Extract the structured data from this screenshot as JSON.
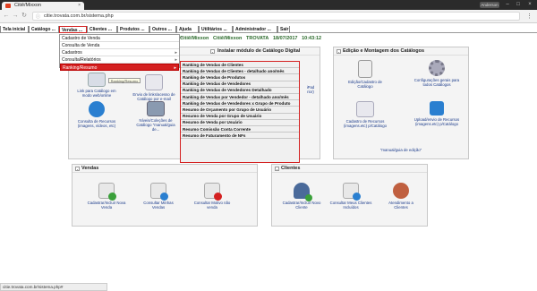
{
  "browser": {
    "tab_title": "Citiê/Mixxon",
    "tab_close": "×",
    "user": "Anderson",
    "url": "citie.trovata.com.br/sistema.php",
    "window_buttons": [
      "–",
      "□",
      "×"
    ]
  },
  "menubar": {
    "items": [
      "Tela inicial",
      "Catálogo ...",
      "Vendas ...",
      "Clientes ...",
      "Produtos ...",
      "Outros ...",
      "Ajuda ...",
      "Utilitários ...",
      "Administrador ...",
      "Sair"
    ],
    "active_index": 2
  },
  "vendas_menu": {
    "items": [
      {
        "label": "Cadastro de Venda",
        "submenu": false
      },
      {
        "label": "Consulta de Venda",
        "submenu": false
      },
      {
        "label": "Cadastros",
        "submenu": true
      },
      {
        "label": "Consulta/Relatórios",
        "submenu": true
      },
      {
        "label": "Ranking/Resumo",
        "submenu": true,
        "highlighted": true
      }
    ],
    "arrow": "▸"
  },
  "ranking_submenu": {
    "items": [
      "Ranking de Vendas de Clientes",
      "Ranking de Vendas de Clientes - detalhado ano/mês",
      "Ranking de Vendas de Produtos",
      "Ranking de Vendas de Vendedores",
      "Ranking de Vendas de Vendedores Detalhado",
      "Ranking de Vendas por Vendedor - detalhado ano/mês",
      "Ranking de Vendas de Vendedores x Grupo de Produto",
      "Resumo de Orçamento por Grupo de Usuário",
      "Resumo de Venda por Grupo de Usuário",
      "Resumo de Venda por Usuário",
      "Resumo Comissão Conta Corrente",
      "Resumo de Faturamento de NFs"
    ]
  },
  "info_strip": {
    "company": "Citiê/Mixxon",
    "company2": "Citiê/Mixxon",
    "system": "TROVATA",
    "date": "18/07/2017",
    "time": "10:43:12"
  },
  "panel_catalogo": {
    "title": "Instalar módulo de Catálogo Digital",
    "toggle": "-",
    "tooltip": "Ranking/Resumo",
    "items": [
      {
        "label": "Link para Catálogo em modo web/online",
        "icon": "link-icon"
      },
      {
        "label": "Envio de links/acesso de Catálogo por e-mail",
        "icon": "email-icon"
      },
      {
        "label": "Consulta de Recursos (imagens, vídeos, etc)",
        "icon": "globe-icon"
      },
      {
        "label": "Níveis/Coleções de Catálogo \"manual/guia de...",
        "icon": "document-icon"
      },
      {
        "label": "iPad",
        "icon": "tablet-icon"
      },
      {
        "label": "rior)",
        "icon": "tablet-icon"
      }
    ]
  },
  "panel_edicao": {
    "title": "Edição e Montagem dos Catálogos",
    "toggle": "-",
    "items": [
      {
        "label": "Edição/Cadastro de Catálogo",
        "icon": "catalog-icon"
      },
      {
        "label": "Configurações gerais para todos Catálogos",
        "icon": "gear-icon"
      },
      {
        "label": "Cadastro de Recursos (imagens.etc) p/Catálogo",
        "icon": "media-icon"
      },
      {
        "label": "Upload/envio de Recursos (imagens.etc) p/Catálogo",
        "icon": "upload-icon"
      },
      {
        "label": "\"manual/guia de edição\"",
        "icon": "manual-icon"
      }
    ]
  },
  "panel_vendas": {
    "title": "Vendas",
    "toggle": "-",
    "items": [
      {
        "label": "Cadastrar/Incluir Nova Venda",
        "icon": "add-sale-icon"
      },
      {
        "label": "Consultar Minhas Vendas",
        "icon": "search-sale-icon"
      },
      {
        "label": "Consultar Motivo não venda",
        "icon": "error-sale-icon"
      }
    ]
  },
  "panel_clientes": {
    "title": "Clientes",
    "toggle": "-",
    "items": [
      {
        "label": "Cadastrar/Incluir Novo Cliente",
        "icon": "add-client-icon"
      },
      {
        "label": "Consultar Meus Clientes Incluídos",
        "icon": "search-client-icon"
      },
      {
        "label": "Atendimento a Clientes",
        "icon": "support-icon"
      }
    ]
  },
  "statusbar": "citie.trovata.com.br/sistema.php#"
}
